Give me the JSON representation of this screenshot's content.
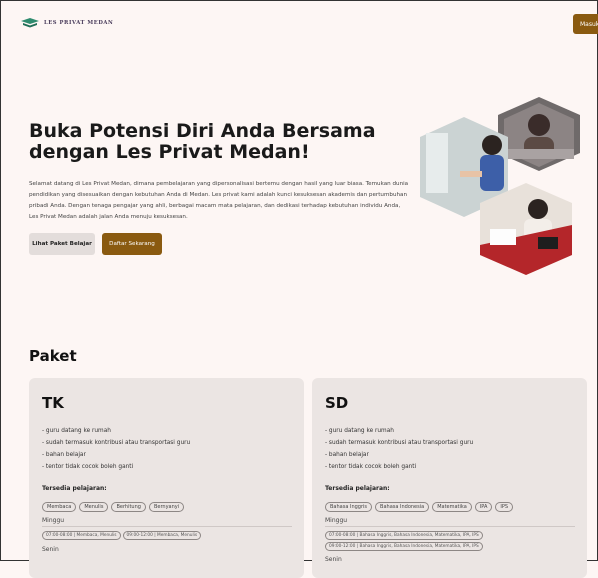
{
  "brand": {
    "name": "LES PRIVAT MEDAN"
  },
  "nav": {
    "login_label": "Masuk"
  },
  "hero": {
    "title": "Buka Potensi Diri Anda Bersama dengan Les Privat Medan!",
    "description": "Selamat datang di Les Privat Medan, dimana pembelajaran yang dipersonalisasi bertemu dengan hasil yang luar biasa. Temukan dunia pendidikan yang disesuaikan dengan kebutuhan Anda di Medan. Les privat kami adalah kunci kesuksesan akademis dan pertumbuhan pribadi Anda. Dengan tenaga pengajar yang ahli, berbagai macam mata pelajaran, dan dedikasi terhadap kebutuhan individu Anda, Les Privat Medan adalah jalan Anda menuju kesuksesan.",
    "btn_packages": "Lihat Paket Belajar",
    "btn_register": "Daftar Sekarang"
  },
  "packages": {
    "title": "Paket",
    "available_label": "Tersedia pelajaran:",
    "cards": [
      {
        "name": "TK",
        "features": [
          "- guru datang ke rumah",
          "- sudah termasuk kontribusi atau transportasi guru",
          "- bahan belajar",
          "- tentor tidak cocok boleh ganti"
        ],
        "subjects": [
          "Membaca",
          "Menulis",
          "Berhitung",
          "Bernyanyi"
        ],
        "day1": "Minggu",
        "slots": [
          "07:00-08:00 | Membaca, Menulis",
          "09:00-12:00 | Membaca, Menulis"
        ],
        "day2": "Senin"
      },
      {
        "name": "SD",
        "features": [
          "- guru datang ke rumah",
          "- sudah termasuk kontribusi atau transportasi guru",
          "- bahan belajar",
          "- tentor tidak cocok boleh ganti"
        ],
        "subjects": [
          "Bahasa Inggris",
          "Bahasa Indonesia",
          "Matematika",
          "IPA",
          "IPS"
        ],
        "day1": "Minggu",
        "slots": [
          "07:00-08:00 | Bahasa Inggris, Bahasa Indonesia, Matematika, IPA, IPS",
          "09:00-12:00 | Bahasa Inggris, Bahasa Indonesia, Matematika, IPA, IPS"
        ],
        "day2": "Senin"
      }
    ]
  }
}
